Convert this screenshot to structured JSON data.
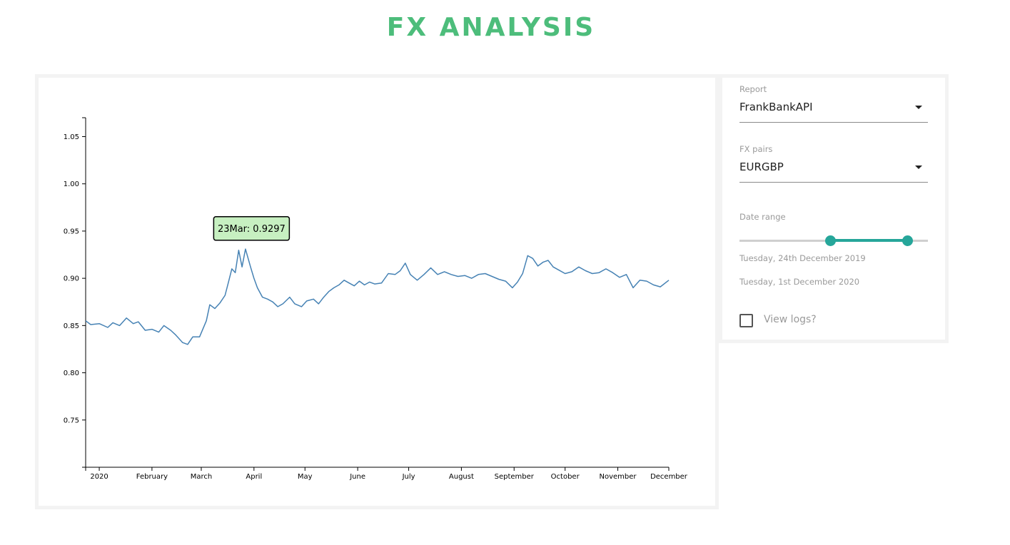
{
  "header": {
    "title": "FX ANALYSIS"
  },
  "colors": {
    "title": "#4dbd7b",
    "line": "#4682b4",
    "tooltip_bg": "#c7f0c1",
    "accent": "#26a69a"
  },
  "controls": {
    "report": {
      "label": "Report",
      "value": "FrankBankAPI"
    },
    "fx_pairs": {
      "label": "FX pairs",
      "value": "EURGBP"
    },
    "date_range": {
      "label": "Date range",
      "start_fraction": 0.48,
      "end_fraction": 0.89,
      "start_text": "Tuesday, 24th December 2019",
      "end_text": "Tuesday, 1st December 2020"
    },
    "view_logs": {
      "label": "View logs?",
      "checked": false
    }
  },
  "tooltip": {
    "text": "23Mar: 0.9297"
  },
  "chart_data": {
    "type": "line",
    "title": "",
    "xlabel": "",
    "ylabel": "",
    "xlim": [
      "2019-12-24",
      "2020-12-01"
    ],
    "ylim": [
      0.7,
      1.07
    ],
    "y_ticks": [
      0.75,
      0.8,
      0.85,
      0.9,
      0.95,
      1.0,
      1.05
    ],
    "y_tick_labels": [
      "0.75",
      "0.80",
      "0.85",
      "0.90",
      "0.95",
      "1.00",
      "1.05"
    ],
    "x_ticks": [
      "2020-01-01",
      "2020-02-01",
      "2020-03-01",
      "2020-04-01",
      "2020-05-01",
      "2020-06-01",
      "2020-07-01",
      "2020-08-01",
      "2020-09-01",
      "2020-10-01",
      "2020-11-01",
      "2020-12-01"
    ],
    "x_tick_labels": [
      "2020",
      "February",
      "March",
      "April",
      "May",
      "June",
      "July",
      "August",
      "September",
      "October",
      "November",
      "December"
    ],
    "grid": false,
    "highlight": {
      "x": "2020-03-23",
      "y": 0.9297
    },
    "series": [
      {
        "x": [
          "2019-12-24",
          "2019-12-27",
          "2020-01-01",
          "2020-01-06",
          "2020-01-09",
          "2020-01-13",
          "2020-01-17",
          "2020-01-21",
          "2020-01-24",
          "2020-01-28",
          "2020-02-01",
          "2020-02-05",
          "2020-02-08",
          "2020-02-12",
          "2020-02-15",
          "2020-02-19",
          "2020-02-22",
          "2020-02-25",
          "2020-02-29",
          "2020-03-04",
          "2020-03-06",
          "2020-03-09",
          "2020-03-12",
          "2020-03-15",
          "2020-03-17",
          "2020-03-19",
          "2020-03-21",
          "2020-03-23",
          "2020-03-25",
          "2020-03-27",
          "2020-03-30",
          "2020-04-01",
          "2020-04-03",
          "2020-04-06",
          "2020-04-09",
          "2020-04-12",
          "2020-04-15",
          "2020-04-18",
          "2020-04-22",
          "2020-04-25",
          "2020-04-29",
          "2020-05-02",
          "2020-05-06",
          "2020-05-09",
          "2020-05-12",
          "2020-05-15",
          "2020-05-18",
          "2020-05-21",
          "2020-05-24",
          "2020-05-27",
          "2020-05-30",
          "2020-06-02",
          "2020-06-05",
          "2020-06-08",
          "2020-06-11",
          "2020-06-15",
          "2020-06-19",
          "2020-06-23",
          "2020-06-26",
          "2020-06-29",
          "2020-07-02",
          "2020-07-06",
          "2020-07-10",
          "2020-07-14",
          "2020-07-18",
          "2020-07-22",
          "2020-07-26",
          "2020-07-30",
          "2020-08-03",
          "2020-08-07",
          "2020-08-11",
          "2020-08-15",
          "2020-08-19",
          "2020-08-23",
          "2020-08-27",
          "2020-08-31",
          "2020-09-03",
          "2020-09-06",
          "2020-09-09",
          "2020-09-12",
          "2020-09-15",
          "2020-09-18",
          "2020-09-21",
          "2020-09-24",
          "2020-09-27",
          "2020-10-01",
          "2020-10-05",
          "2020-10-09",
          "2020-10-13",
          "2020-10-17",
          "2020-10-21",
          "2020-10-25",
          "2020-10-29",
          "2020-11-02",
          "2020-11-06",
          "2020-11-10",
          "2020-11-14",
          "2020-11-18",
          "2020-11-22",
          "2020-11-26",
          "2020-12-01"
        ],
        "values": [
          0.855,
          0.851,
          0.852,
          0.848,
          0.853,
          0.85,
          0.858,
          0.852,
          0.854,
          0.845,
          0.846,
          0.843,
          0.85,
          0.845,
          0.84,
          0.832,
          0.83,
          0.838,
          0.838,
          0.855,
          0.872,
          0.868,
          0.874,
          0.882,
          0.896,
          0.91,
          0.906,
          0.9297,
          0.912,
          0.931,
          0.912,
          0.9,
          0.89,
          0.88,
          0.878,
          0.875,
          0.87,
          0.873,
          0.88,
          0.873,
          0.87,
          0.876,
          0.878,
          0.873,
          0.88,
          0.886,
          0.89,
          0.893,
          0.898,
          0.895,
          0.892,
          0.897,
          0.893,
          0.896,
          0.894,
          0.895,
          0.905,
          0.904,
          0.908,
          0.916,
          0.904,
          0.898,
          0.904,
          0.911,
          0.904,
          0.907,
          0.904,
          0.902,
          0.903,
          0.9,
          0.904,
          0.905,
          0.902,
          0.899,
          0.897,
          0.89,
          0.896,
          0.905,
          0.924,
          0.921,
          0.913,
          0.917,
          0.919,
          0.912,
          0.909,
          0.905,
          0.907,
          0.912,
          0.908,
          0.905,
          0.906,
          0.91,
          0.906,
          0.901,
          0.904,
          0.89,
          0.898,
          0.897,
          0.893,
          0.891,
          0.898
        ]
      }
    ]
  }
}
